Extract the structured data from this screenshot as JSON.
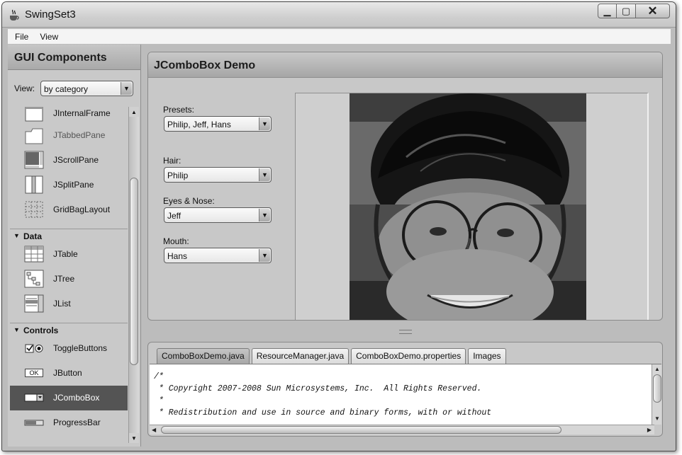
{
  "window": {
    "title": "SwingSet3",
    "minimize_glyph": "▁",
    "maximize_glyph": "▢",
    "close_glyph": "✕"
  },
  "menu": {
    "items": [
      "File",
      "View"
    ]
  },
  "sidebar": {
    "title": "GUI Components",
    "view_label": "View:",
    "view_value": "by category",
    "items": [
      {
        "label": "JInternalFrame",
        "icon": "internal-frame-icon"
      },
      {
        "label": "JTabbedPane",
        "icon": "tabbed-pane-icon"
      },
      {
        "label": "JScrollPane",
        "icon": "scroll-pane-icon"
      },
      {
        "label": "JSplitPane",
        "icon": "split-pane-icon"
      },
      {
        "label": "GridBagLayout",
        "icon": "gridbag-icon"
      }
    ],
    "categories": [
      {
        "label": "Data",
        "items": [
          "JTable",
          "JTree",
          "JList"
        ]
      },
      {
        "label": "Controls",
        "items": [
          "ToggleButtons",
          "JButton",
          "JComboBox",
          "ProgressBar"
        ]
      }
    ],
    "button_icon_text": "OK",
    "selected": "JComboBox"
  },
  "demo": {
    "title": "JComboBox Demo",
    "fields": [
      {
        "label": "Presets:",
        "value": "Philip, Jeff, Hans"
      },
      {
        "label": "Hair:",
        "value": "Philip"
      },
      {
        "label": "Eyes & Nose:",
        "value": "Jeff"
      },
      {
        "label": "Mouth:",
        "value": "Hans"
      }
    ]
  },
  "source": {
    "tabs": [
      "ComboBoxDemo.java",
      "ResourceManager.java",
      "ComboBoxDemo.properties",
      "Images"
    ],
    "active_tab": "ComboBoxDemo.java",
    "code_lines": [
      "/*",
      " * Copyright 2007-2008 Sun Microsystems, Inc.  All Rights Reserved.",
      " *",
      " * Redistribution and use in source and binary forms, with or without"
    ]
  },
  "colors": {
    "selected_bg": "#545454",
    "panel_bg": "#c8c8c8"
  }
}
